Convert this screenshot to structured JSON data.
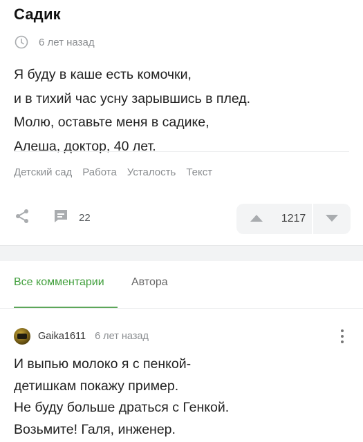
{
  "post": {
    "title": "Садик",
    "time": "6 лет назад",
    "story_lines": [
      "Я буду в каше есть комочки,",
      "и в тихий час усну зарывшись в плед.",
      "Молю, оставьте меня в садике,",
      "Алеша, доктор, 40 лет."
    ],
    "tags": [
      "Детский сад",
      "Работа",
      "Усталость",
      "Текст"
    ],
    "comments_count": "22",
    "rating": "1217"
  },
  "comments": {
    "tabs": [
      "Все комментарии",
      "Автора"
    ],
    "comment": {
      "author": "Gaika1611",
      "time": "6 лет назад",
      "lines": [
        "И выпью молоко я с пенкой-",
        "детишкам покажу пример.",
        "Не буду больше драться с Генкой.",
        "Возьмите! Галя, инженер."
      ]
    }
  },
  "colors": {
    "accent": "#3f9e3a",
    "muted": "#8a8d90",
    "icon": "#a9acaf"
  },
  "icons": [
    "clock-icon",
    "share-icon",
    "comment-icon",
    "arrow-up-icon",
    "arrow-down-icon",
    "more-icon"
  ]
}
